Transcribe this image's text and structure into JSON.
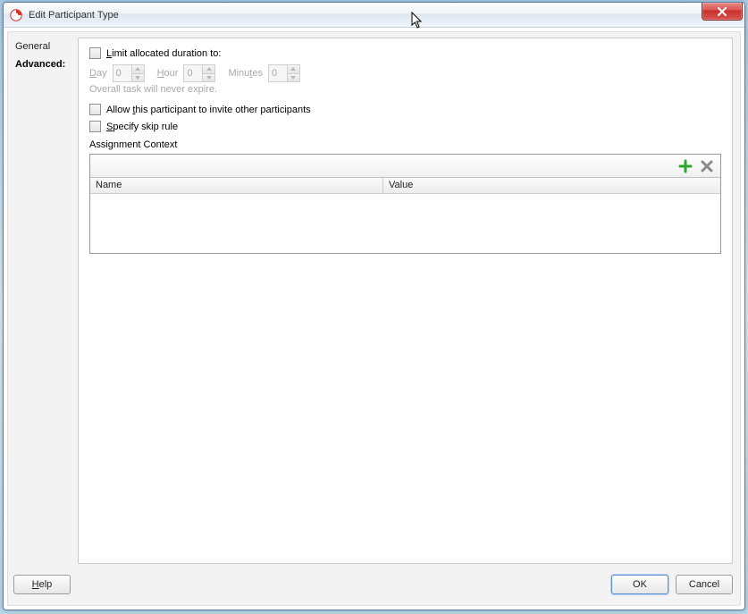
{
  "window": {
    "title": "Edit Participant Type"
  },
  "tabs": {
    "general": "General",
    "advanced": "Advanced:",
    "active": "advanced"
  },
  "limit": {
    "label_pre": "L",
    "label_post": "imit allocated duration to:",
    "checked": false
  },
  "duration": {
    "day_label_pre": "D",
    "day_label_post": "ay",
    "day_value": "0",
    "hour_label_pre": "H",
    "hour_label_post": "our",
    "hour_value": "0",
    "min_label_pre": "Minu",
    "min_label_post": "t",
    "min_label_tail": "es",
    "min_value": "0",
    "hint": "Overall task will never expire."
  },
  "allow_invite": {
    "label_pre": "Allow ",
    "label_mn": "t",
    "label_post": "his participant to invite other participants",
    "checked": false
  },
  "skip_rule": {
    "label_pre": "S",
    "label_post": "pecify skip rule",
    "checked": false
  },
  "assignment_context": {
    "label": "Assignment Context",
    "columns": {
      "name": "Name",
      "value": "Value"
    },
    "rows": []
  },
  "buttons": {
    "help_pre": "H",
    "help_post": "elp",
    "ok": "OK",
    "cancel": "Cancel"
  }
}
